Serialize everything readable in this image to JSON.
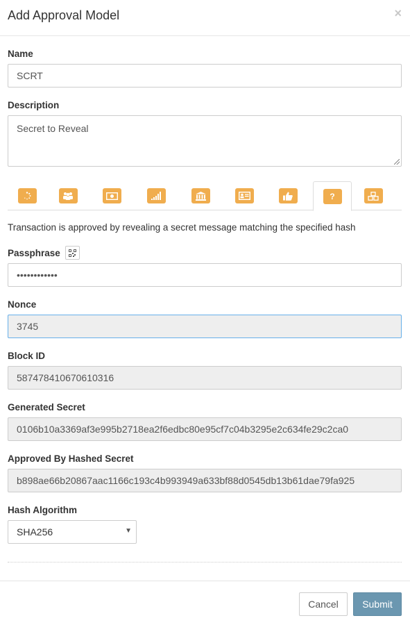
{
  "modal": {
    "title": "Add Approval Model",
    "close_glyph": "×"
  },
  "form": {
    "name_label": "Name",
    "name_value": "SCRT",
    "description_label": "Description",
    "description_value": "Secret to Reveal",
    "tabs": [
      {
        "icon": "spinner-icon"
      },
      {
        "icon": "users-icon"
      },
      {
        "icon": "money-icon"
      },
      {
        "icon": "signal-icon"
      },
      {
        "icon": "bank-icon"
      },
      {
        "icon": "id-card-icon"
      },
      {
        "icon": "thumbs-up-icon"
      },
      {
        "icon": "question-icon",
        "glyph": "?",
        "active": true
      },
      {
        "icon": "cubes-icon"
      }
    ],
    "tab_description": "Transaction is approved by revealing a secret message matching the specified hash",
    "passphrase_label": "Passphrase",
    "passphrase_value": "••••••••••••",
    "nonce_label": "Nonce",
    "nonce_value": "3745",
    "block_id_label": "Block ID",
    "block_id_value": "587478410670610316",
    "generated_secret_label": "Generated Secret",
    "generated_secret_value": "0106b10a3369af3e995b2718ea2f6edbc80e95cf7c04b3295e2c634fe29c2ca0",
    "hashed_secret_label": "Approved By Hashed Secret",
    "hashed_secret_value": "b898ae66b20867aac1166c193c4b993949a633bf88d0545db13b61dae79fa925",
    "hash_algorithm_label": "Hash Algorithm",
    "hash_algorithm_value": "SHA256",
    "caret_glyph": "▼"
  },
  "footer": {
    "cancel_label": "Cancel",
    "submit_label": "Submit"
  },
  "colors": {
    "accent": "#f0ad4e",
    "submit": "#6b97b0",
    "readonly_bg": "#eeeeee",
    "focus_border": "#66afe9"
  }
}
